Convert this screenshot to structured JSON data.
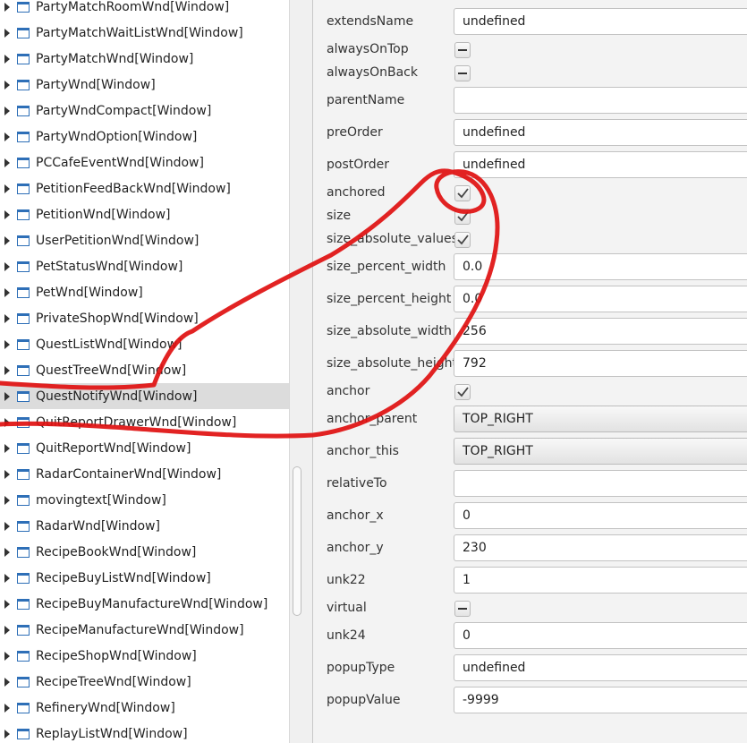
{
  "tree": {
    "items": [
      {
        "label": "PartyMatchRoomWnd[Window]"
      },
      {
        "label": "PartyMatchWaitListWnd[Window]"
      },
      {
        "label": "PartyMatchWnd[Window]"
      },
      {
        "label": "PartyWnd[Window]"
      },
      {
        "label": "PartyWndCompact[Window]"
      },
      {
        "label": "PartyWndOption[Window]"
      },
      {
        "label": "PCCafeEventWnd[Window]"
      },
      {
        "label": "PetitionFeedBackWnd[Window]"
      },
      {
        "label": "PetitionWnd[Window]"
      },
      {
        "label": "UserPetitionWnd[Window]"
      },
      {
        "label": "PetStatusWnd[Window]"
      },
      {
        "label": "PetWnd[Window]"
      },
      {
        "label": "PrivateShopWnd[Window]"
      },
      {
        "label": "QuestListWnd[Window]"
      },
      {
        "label": "QuestTreeWnd[Window]"
      },
      {
        "label": "QuestNotifyWnd[Window]",
        "selected": true
      },
      {
        "label": "QuitReportDrawerWnd[Window]"
      },
      {
        "label": "QuitReportWnd[Window]"
      },
      {
        "label": "RadarContainerWnd[Window]"
      },
      {
        "label": "movingtext[Window]"
      },
      {
        "label": "RadarWnd[Window]"
      },
      {
        "label": "RecipeBookWnd[Window]"
      },
      {
        "label": "RecipeBuyListWnd[Window]"
      },
      {
        "label": "RecipeBuyManufactureWnd[Window]"
      },
      {
        "label": "RecipeManufactureWnd[Window]"
      },
      {
        "label": "RecipeShopWnd[Window]"
      },
      {
        "label": "RecipeTreeWnd[Window]"
      },
      {
        "label": "RefineryWnd[Window]"
      },
      {
        "label": "ReplayListWnd[Window]"
      }
    ]
  },
  "properties": {
    "extendsName": {
      "label": "extendsName",
      "value": "undefined"
    },
    "alwaysOnTop": {
      "label": "alwaysOnTop",
      "state": "indeterminate"
    },
    "alwaysOnBack": {
      "label": "alwaysOnBack",
      "state": "indeterminate"
    },
    "parentName": {
      "label": "parentName",
      "value": ""
    },
    "preOrder": {
      "label": "preOrder",
      "value": "undefined"
    },
    "postOrder": {
      "label": "postOrder",
      "value": "undefined"
    },
    "anchored": {
      "label": "anchored",
      "state": "checked"
    },
    "size": {
      "label": "size",
      "state": "checked"
    },
    "size_absolute_values": {
      "label": "size_absolute_values",
      "state": "checked"
    },
    "size_percent_width": {
      "label": "size_percent_width",
      "value": "0.0"
    },
    "size_percent_height": {
      "label": "size_percent_height",
      "value": "0.0"
    },
    "size_absolute_width": {
      "label": "size_absolute_width",
      "value": "256"
    },
    "size_absolute_height": {
      "label": "size_absolute_height",
      "value": "792"
    },
    "anchor": {
      "label": "anchor",
      "state": "checked"
    },
    "anchor_parent": {
      "label": "anchor_parent",
      "value": "TOP_RIGHT"
    },
    "anchor_this": {
      "label": "anchor_this",
      "value": "TOP_RIGHT"
    },
    "relativeTo": {
      "label": "relativeTo",
      "value": ""
    },
    "anchor_x": {
      "label": "anchor_x",
      "value": "0"
    },
    "anchor_y": {
      "label": "anchor_y",
      "value": "230"
    },
    "unk22": {
      "label": "unk22",
      "value": "1"
    },
    "virtual": {
      "label": "virtual",
      "state": "indeterminate"
    },
    "unk24": {
      "label": "unk24",
      "value": "0"
    },
    "popupType": {
      "label": "popupType",
      "value": "undefined"
    },
    "popupValue": {
      "label": "popupValue",
      "value": "-9999"
    }
  },
  "colors": {
    "annotation": "#e01010",
    "tree_icon": "#2e6fb7",
    "selection": "#dcdcdc"
  }
}
